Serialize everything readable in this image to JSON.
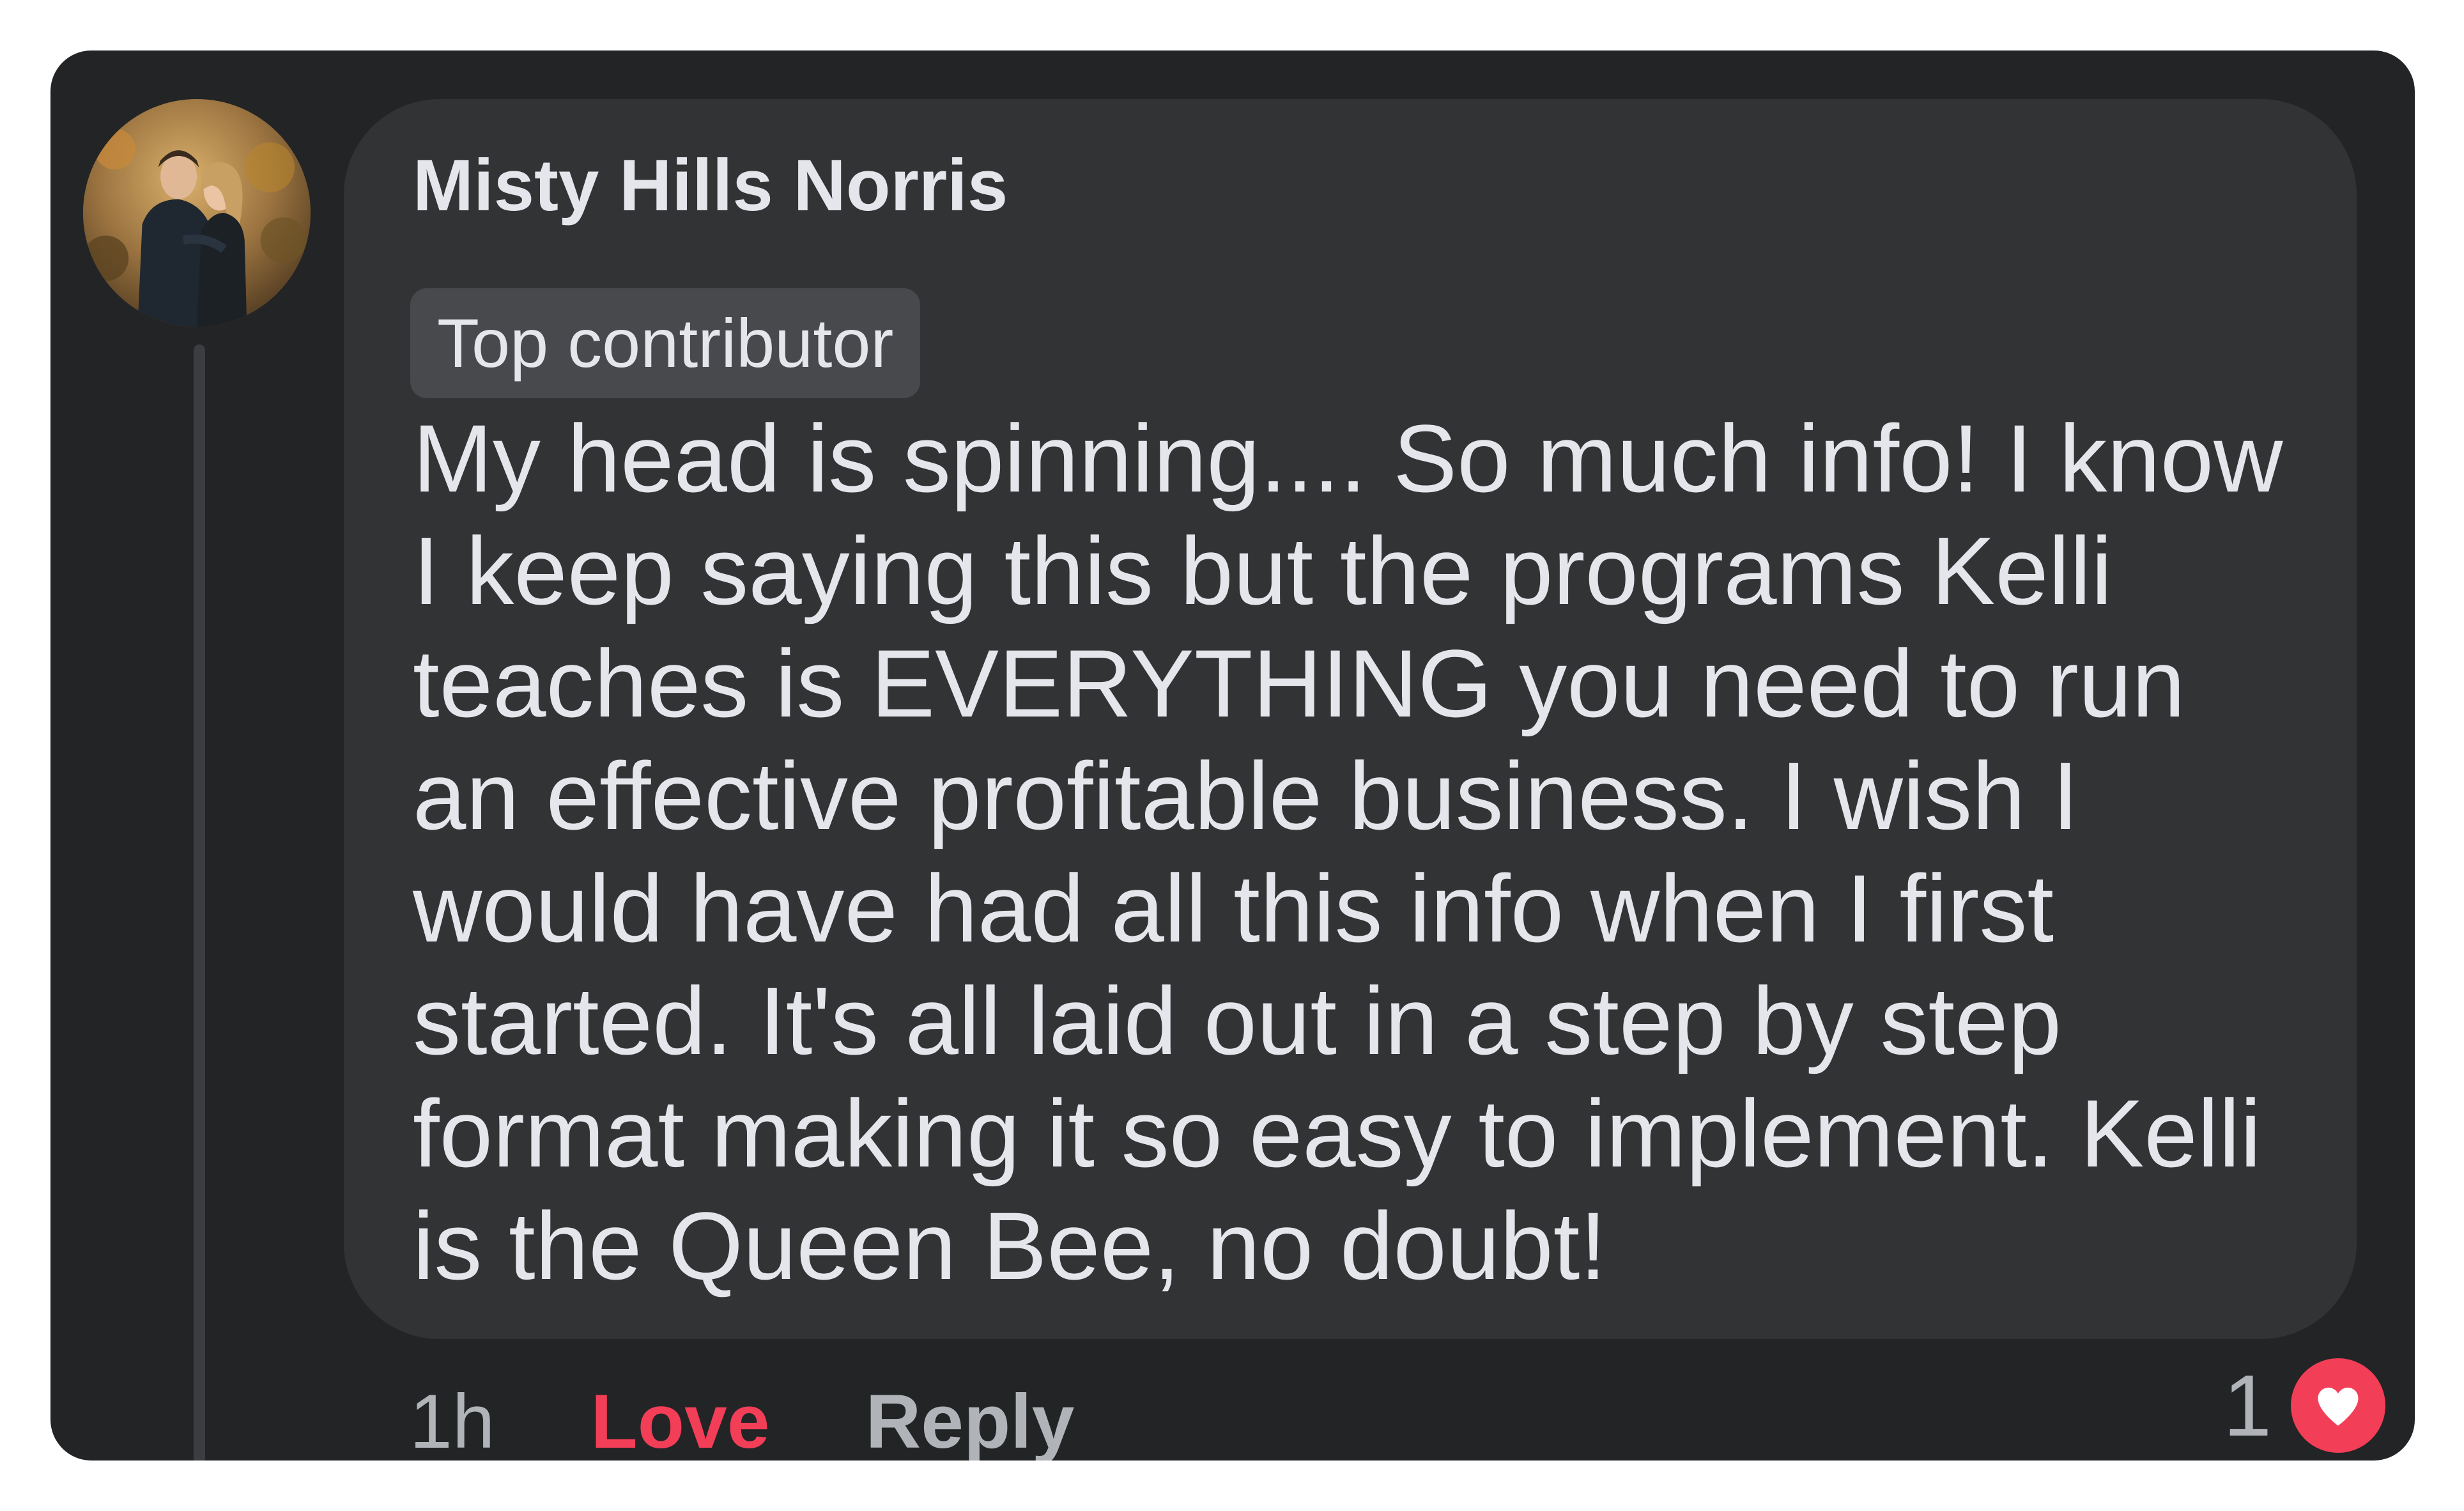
{
  "comment": {
    "author_name": "Misty Hills Norris",
    "badge": "Top contributor",
    "text": "My head is spinning.... So much info! I know I keep saying this but the programs Kelli teaches is EVERYTHING you need to run an effective profitable business. I wish I would have had all this info when I first started. It's all laid out in a step by step format making it so easy to implement. Kelli is the Queen Bee, no doubt!"
  },
  "actions": {
    "time": "1h",
    "love_label": "Love",
    "reply_label": "Reply"
  },
  "reactions": {
    "count": "1",
    "type": "heart-icon"
  },
  "colors": {
    "card_background": "#232426",
    "bubble_background": "#323335",
    "text_primary": "#e4e6eb",
    "text_secondary": "#b0b3b8",
    "love_red": "#f33e58"
  }
}
